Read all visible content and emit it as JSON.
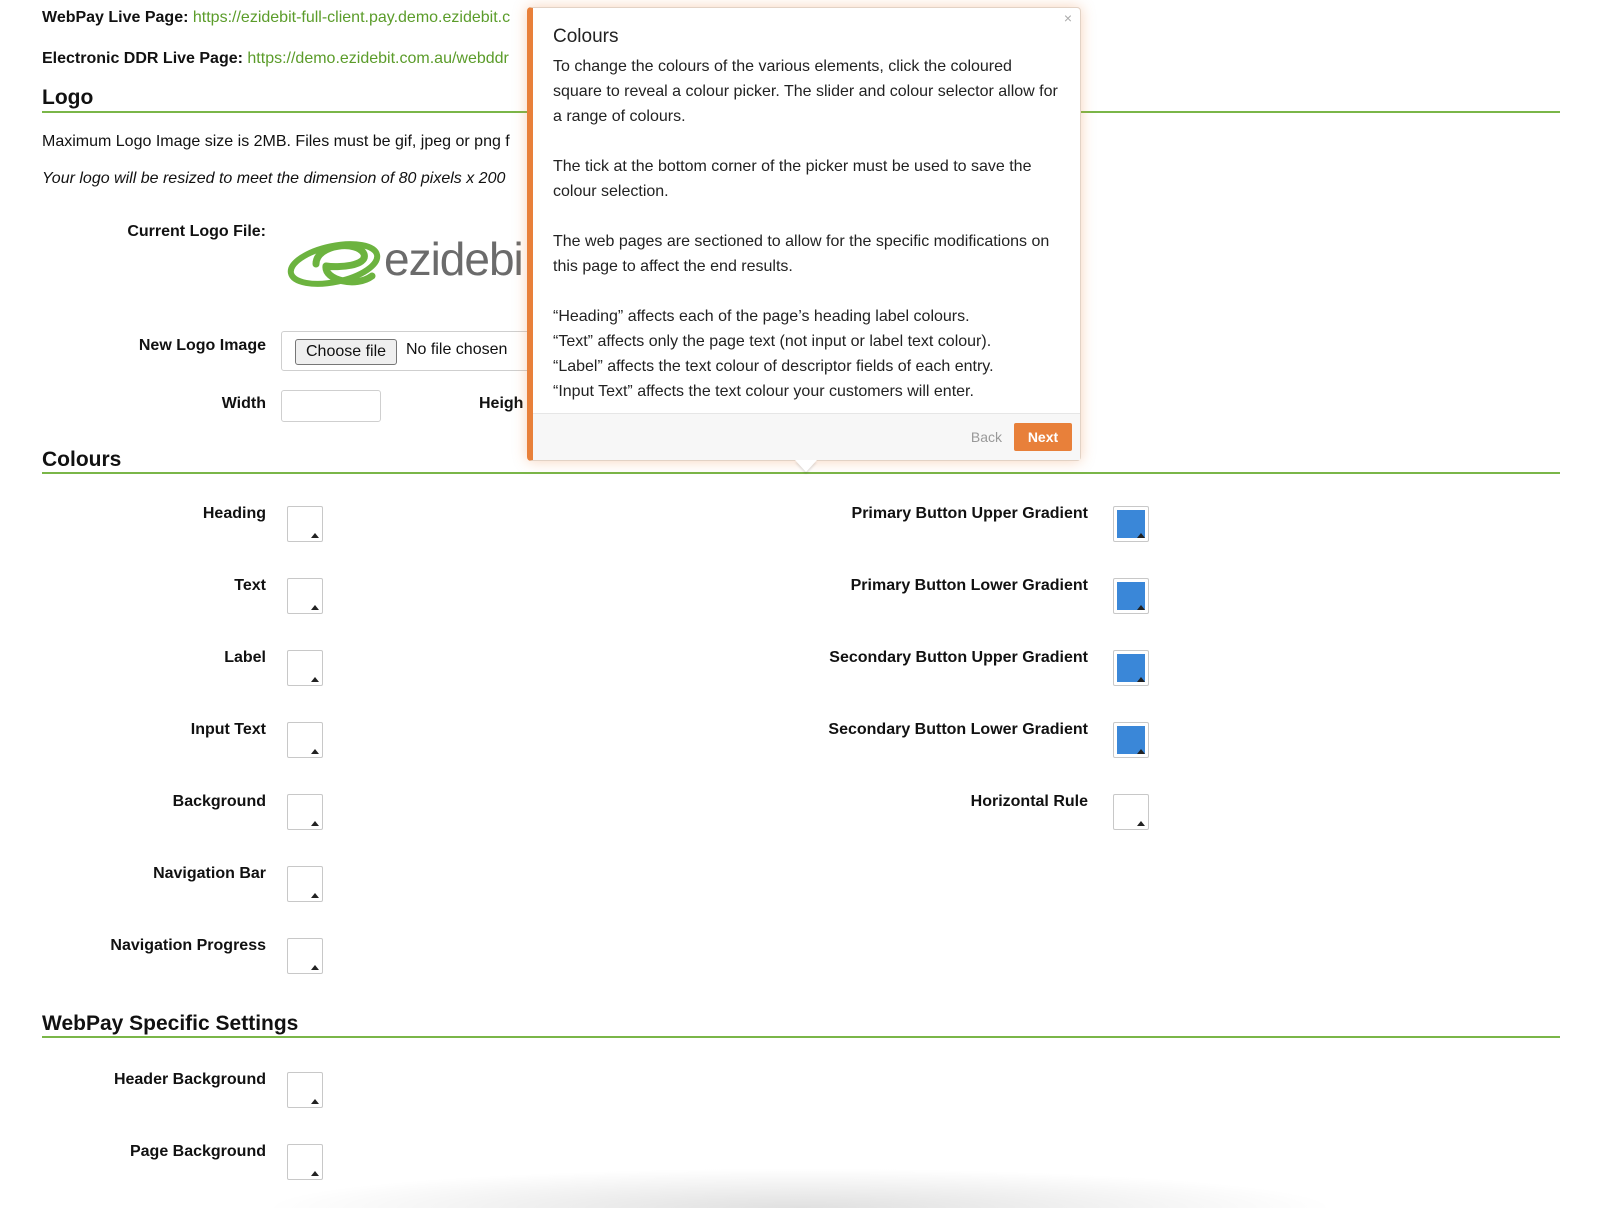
{
  "live_pages": {
    "webpay_label": "WebPay Live Page:",
    "webpay_url": "https://ezidebit-full-client.pay.demo.ezidebit.c",
    "ddr_label": "Electronic DDR Live Page:",
    "ddr_url": "https://demo.ezidebit.com.au/webddr"
  },
  "logo_section": {
    "title": "Logo",
    "max_size_text": "Maximum Logo Image size is 2MB. Files must be gif, jpeg or png f",
    "resize_text": "Your logo will be resized to meet the dimension of 80 pixels x 200",
    "current_logo_label": "Current Logo File:",
    "logo_text": "ezidebi",
    "new_logo_label": "New Logo Image",
    "choose_file_label": "Choose file",
    "no_file_text": "No file chosen",
    "width_label": "Width",
    "width_value": "",
    "height_label": "Heigh"
  },
  "colours_section": {
    "title": "Colours",
    "left_fields": [
      {
        "label": "Heading",
        "color": "#ffffff"
      },
      {
        "label": "Text",
        "color": "#ffffff"
      },
      {
        "label": "Label",
        "color": "#ffffff"
      },
      {
        "label": "Input Text",
        "color": "#ffffff"
      },
      {
        "label": "Background",
        "color": "#ffffff"
      },
      {
        "label": "Navigation Bar",
        "color": "#ffffff"
      },
      {
        "label": "Navigation Progress",
        "color": "#ffffff"
      }
    ],
    "right_fields": [
      {
        "label": "Primary Button Upper Gradient",
        "color": "#3a87d8"
      },
      {
        "label": "Primary Button Lower Gradient",
        "color": "#3a87d8"
      },
      {
        "label": "Secondary Button Upper Gradient",
        "color": "#3a87d8"
      },
      {
        "label": "Secondary Button Lower Gradient",
        "color": "#3a87d8"
      },
      {
        "label": "Horizontal Rule",
        "color": "#ffffff"
      }
    ]
  },
  "webpay_section": {
    "title": "WebPay Specific Settings",
    "fields": [
      {
        "label": "Header Background",
        "color": "#ffffff"
      },
      {
        "label": "Page Background",
        "color": "#ffffff"
      }
    ]
  },
  "popover": {
    "close": "×",
    "title": "Colours",
    "para1": "To change the colours of the various elements, click the coloured square to reveal a colour picker. The slider and colour selector allow for a range of colours.",
    "para2": "The tick at the bottom corner of the picker must be used to save the colour selection.",
    "para3": "The web pages are sectioned to allow for the specific modifications on this page to affect the end results.",
    "line_heading": "“Heading” affects each of the page’s heading label colours.",
    "line_text": "“Text” affects only the page text (not input or label text colour).",
    "line_label": "“Label” affects the text colour of descriptor fields of each entry.",
    "line_input": "“Input Text” affects the text colour your customers will enter.",
    "back_label": "Back",
    "next_label": "Next"
  },
  "colors": {
    "accent_green": "#7ab648",
    "link_green": "#5b9c2a",
    "tour_orange": "#e8803a",
    "swatch_blue": "#3a87d8"
  }
}
